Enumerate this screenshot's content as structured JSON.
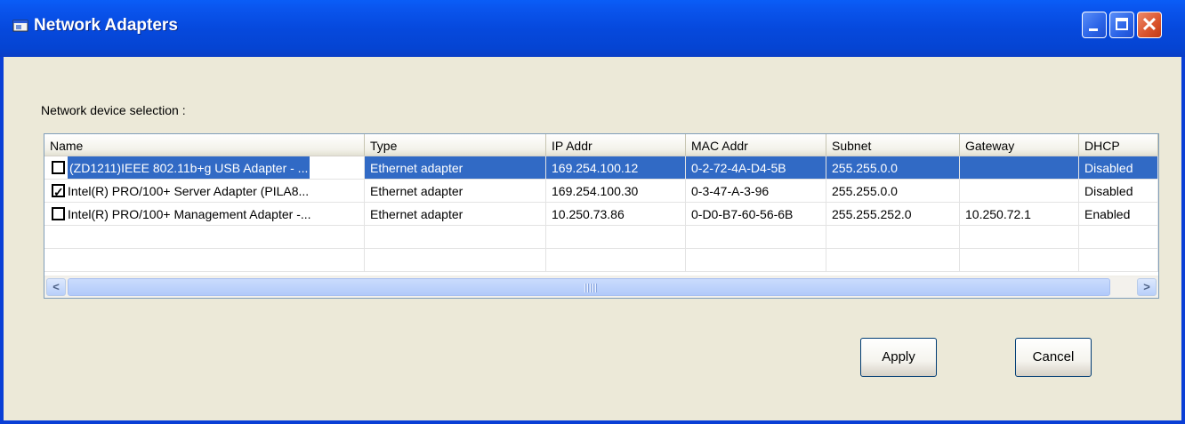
{
  "window": {
    "title": "Network Adapters"
  },
  "section_label": "Network device selection :",
  "columns": [
    {
      "label": "Name"
    },
    {
      "label": "Type"
    },
    {
      "label": "IP Addr"
    },
    {
      "label": "MAC Addr"
    },
    {
      "label": "Subnet"
    },
    {
      "label": "Gateway"
    },
    {
      "label": "DHCP"
    }
  ],
  "rows": [
    {
      "checked": false,
      "selected": true,
      "cells": [
        "(ZD1211)IEEE 802.11b+g USB Adapter - ...",
        "Ethernet adapter",
        "169.254.100.12",
        "0-2-72-4A-D4-5B",
        "255.255.0.0",
        "",
        "Disabled"
      ]
    },
    {
      "checked": true,
      "selected": false,
      "cells": [
        "Intel(R) PRO/100+ Server Adapter (PILA8...",
        "Ethernet adapter",
        "169.254.100.30",
        "0-3-47-A-3-96",
        "255.255.0.0",
        "",
        "Disabled"
      ]
    },
    {
      "checked": false,
      "selected": false,
      "cells": [
        "Intel(R) PRO/100+ Management Adapter -...",
        "Ethernet adapter",
        "10.250.73.86",
        "0-D0-B7-60-56-6B",
        "255.255.252.0",
        "10.250.72.1",
        "Enabled"
      ]
    }
  ],
  "buttons": {
    "apply": "Apply",
    "cancel": "Cancel"
  },
  "colors": {
    "title_bar": "#0a55ee",
    "selection": "#316ac5",
    "dialog_bg": "#ece9d8",
    "close_button": "#d9532c"
  }
}
